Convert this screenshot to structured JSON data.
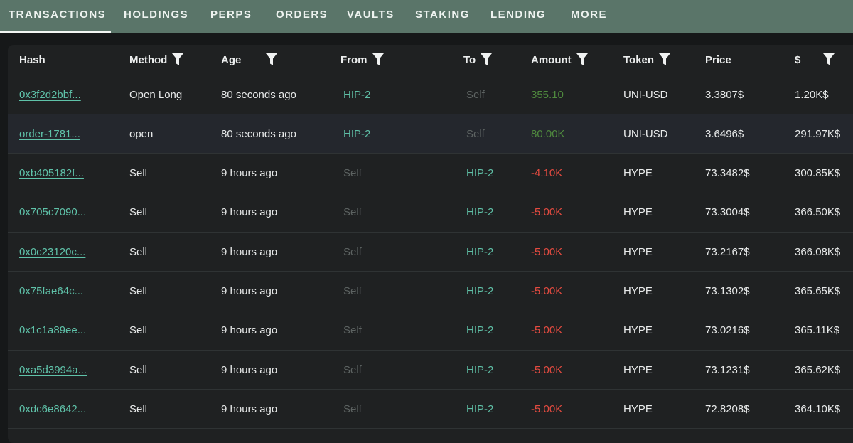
{
  "tabs": [
    {
      "label": "TRANSACTIONS",
      "active": true
    },
    {
      "label": "HOLDINGS"
    },
    {
      "label": "PERPS"
    },
    {
      "label": "ORDERS"
    },
    {
      "label": "VAULTS"
    },
    {
      "label": "STAKING"
    },
    {
      "label": "LENDING"
    },
    {
      "label": "MORE"
    }
  ],
  "table": {
    "columns": [
      {
        "label": "Hash",
        "filter": false
      },
      {
        "label": "Method",
        "filter": true
      },
      {
        "label": "Age",
        "filter": true
      },
      {
        "label": "From",
        "filter": true
      },
      {
        "label": "To",
        "filter": true
      },
      {
        "label": "Amount",
        "filter": true
      },
      {
        "label": "Token",
        "filter": true
      },
      {
        "label": "Price",
        "filter": false
      },
      {
        "label": "$",
        "filter": true
      }
    ],
    "rows": [
      {
        "hash": "0x3f2d2bbf...",
        "method": "Open Long",
        "age": "80 seconds ago",
        "from": "HIP-2",
        "to": "Self",
        "amount": "355.10",
        "token": "UNI-USD",
        "price": "3.3807$",
        "usd": "1.20K$"
      },
      {
        "hash": "order-1781...",
        "method": "open",
        "age": "80 seconds ago",
        "from": "HIP-2",
        "to": "Self",
        "amount": "80.00K",
        "token": "UNI-USD",
        "price": "3.6496$",
        "usd": "291.97K$"
      },
      {
        "hash": "0xb405182f...",
        "method": "Sell",
        "age": "9 hours ago",
        "from": "Self",
        "to": "HIP-2",
        "amount": "-4.10K",
        "token": "HYPE",
        "price": "73.3482$",
        "usd": "300.85K$"
      },
      {
        "hash": "0x705c7090...",
        "method": "Sell",
        "age": "9 hours ago",
        "from": "Self",
        "to": "HIP-2",
        "amount": "-5.00K",
        "token": "HYPE",
        "price": "73.3004$",
        "usd": "366.50K$"
      },
      {
        "hash": "0x0c23120c...",
        "method": "Sell",
        "age": "9 hours ago",
        "from": "Self",
        "to": "HIP-2",
        "amount": "-5.00K",
        "token": "HYPE",
        "price": "73.2167$",
        "usd": "366.08K$"
      },
      {
        "hash": "0x75fae64c...",
        "method": "Sell",
        "age": "9 hours ago",
        "from": "Self",
        "to": "HIP-2",
        "amount": "-5.00K",
        "token": "HYPE",
        "price": "73.1302$",
        "usd": "365.65K$"
      },
      {
        "hash": "0x1c1a89ee...",
        "method": "Sell",
        "age": "9 hours ago",
        "from": "Self",
        "to": "HIP-2",
        "amount": "-5.00K",
        "token": "HYPE",
        "price": "73.0216$",
        "usd": "365.11K$"
      },
      {
        "hash": "0xa5d3994a...",
        "method": "Sell",
        "age": "9 hours ago",
        "from": "Self",
        "to": "HIP-2",
        "amount": "-5.00K",
        "token": "HYPE",
        "price": "73.1231$",
        "usd": "365.62K$"
      },
      {
        "hash": "0xdc6e8642...",
        "method": "Sell",
        "age": "9 hours ago",
        "from": "Self",
        "to": "HIP-2",
        "amount": "-5.00K",
        "token": "HYPE",
        "price": "72.8208$",
        "usd": "364.10K$"
      }
    ]
  },
  "colors": {
    "tab_bar": "#5a7569",
    "link": "#5fc2a9",
    "positive": "#4f8a3e",
    "negative": "#e44b40",
    "muted": "#5d6362"
  },
  "icons": {
    "filter": "filter-funnel-icon"
  }
}
